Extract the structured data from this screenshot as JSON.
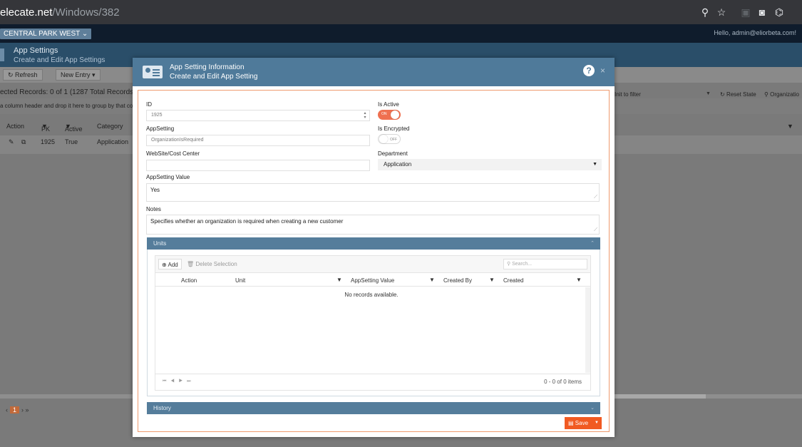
{
  "browser": {
    "url_host": "elecate.net",
    "url_path": "/Windows/382",
    "icons": [
      "zoom-icon",
      "star-icon",
      "extension-icon",
      "profile-icon",
      "puzzle-icon"
    ]
  },
  "topbar": {
    "location": "CENTRAL PARK WEST ⌄",
    "greeting": "Hello, admin@eliorbeta.com!"
  },
  "page": {
    "title": "App Settings",
    "subtitle": "Create and Edit App Settings"
  },
  "toolbar": {
    "refresh": "Refresh",
    "new_entry": "New Entry"
  },
  "grid_bg": {
    "records": "ected Records: 0 of 1 (1287 Total Records)",
    "group_hint": "a column header and drop it here to group by that colu",
    "unit_filter": "Init to filter",
    "reset_state": "Reset State",
    "organization": "Organizatio",
    "cols": [
      "Action",
      "PK",
      "Active",
      "Category"
    ],
    "row": [
      "1925",
      "True",
      "Application"
    ],
    "page_current": "1"
  },
  "modal": {
    "title": "App Setting Information",
    "subtitle": "Create and Edit App Setting",
    "help": "?",
    "close": "×",
    "id_label": "ID",
    "id_value": "1925",
    "is_active_label": "Is Active",
    "is_active_text": "ON",
    "appsetting_label": "AppSetting",
    "appsetting_value": "OrganizationIsRequired",
    "is_encrypted_label": "Is Encrypted",
    "is_encrypted_text": "OFF",
    "website_label": "WebSite/Cost Center",
    "website_value": "",
    "department_label": "Department",
    "department_value": "Application",
    "value_label": "AppSetting Value",
    "value_text": "Yes",
    "notes_label": "Notes",
    "notes_text": "Specifies whether an organization is required when creating a new customer",
    "units_panel": "Units",
    "history_panel": "History",
    "save": "Save",
    "accent": "#f15a22",
    "header_color": "#4f7a9a"
  },
  "units_grid": {
    "add": "Add",
    "delete": "Delete Selection",
    "search_placeholder": "Search...",
    "columns": [
      "Action",
      "Unit",
      "AppSetting Value",
      "Created By",
      "Created"
    ],
    "empty": "No records available.",
    "count": "0 - 0 of 0 items"
  }
}
